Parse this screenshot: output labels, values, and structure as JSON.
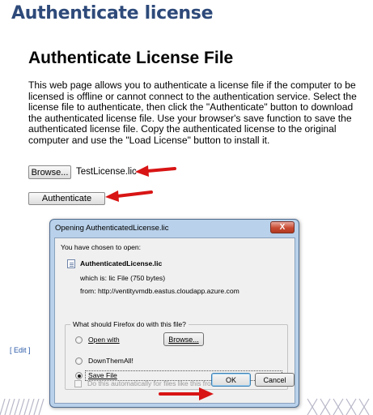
{
  "page": {
    "heading": "Authenticate license",
    "file_title": "Authenticate License File",
    "description": "This web page allows you to authenticate a license file if the computer to be licensed is offline or cannot connect to the authentication service. Select the license file to authenticate, then click the \"Authenticate\" button to download the authenticated license file. Use your browser's save function to save the authenticated license file. Copy the authenticated license to the original computer and use the \"Load License\" button to install it.",
    "browse_label": "Browse...",
    "selected_file": "TestLicense.lic",
    "authenticate_label": "Authenticate",
    "edit_link": "[ Edit ]"
  },
  "dialog": {
    "title": "Opening AuthenticatedLicense.lic",
    "close_label": "X",
    "intro": "You have chosen to open:",
    "file_name": "AuthenticatedLicense.lic",
    "which_is": "which is:  lic File (750 bytes)",
    "from": "from:  http://ventityvmdb.eastus.cloudapp.azure.com",
    "question": "What should Firefox do with this file?",
    "option_open_with": "Open with",
    "browse_label": "Browse...",
    "option_downthemall": "DownThemAll!",
    "option_save_file": "Save File",
    "auto_checkbox_label": "Do this automatically for files like this from now on.",
    "ok_label": "OK",
    "cancel_label": "Cancel"
  },
  "colors": {
    "heading": "#2e4a7a",
    "arrow": "#d81414",
    "dialog_frame": "#b9d1ea",
    "close_button": "#c84a32"
  }
}
